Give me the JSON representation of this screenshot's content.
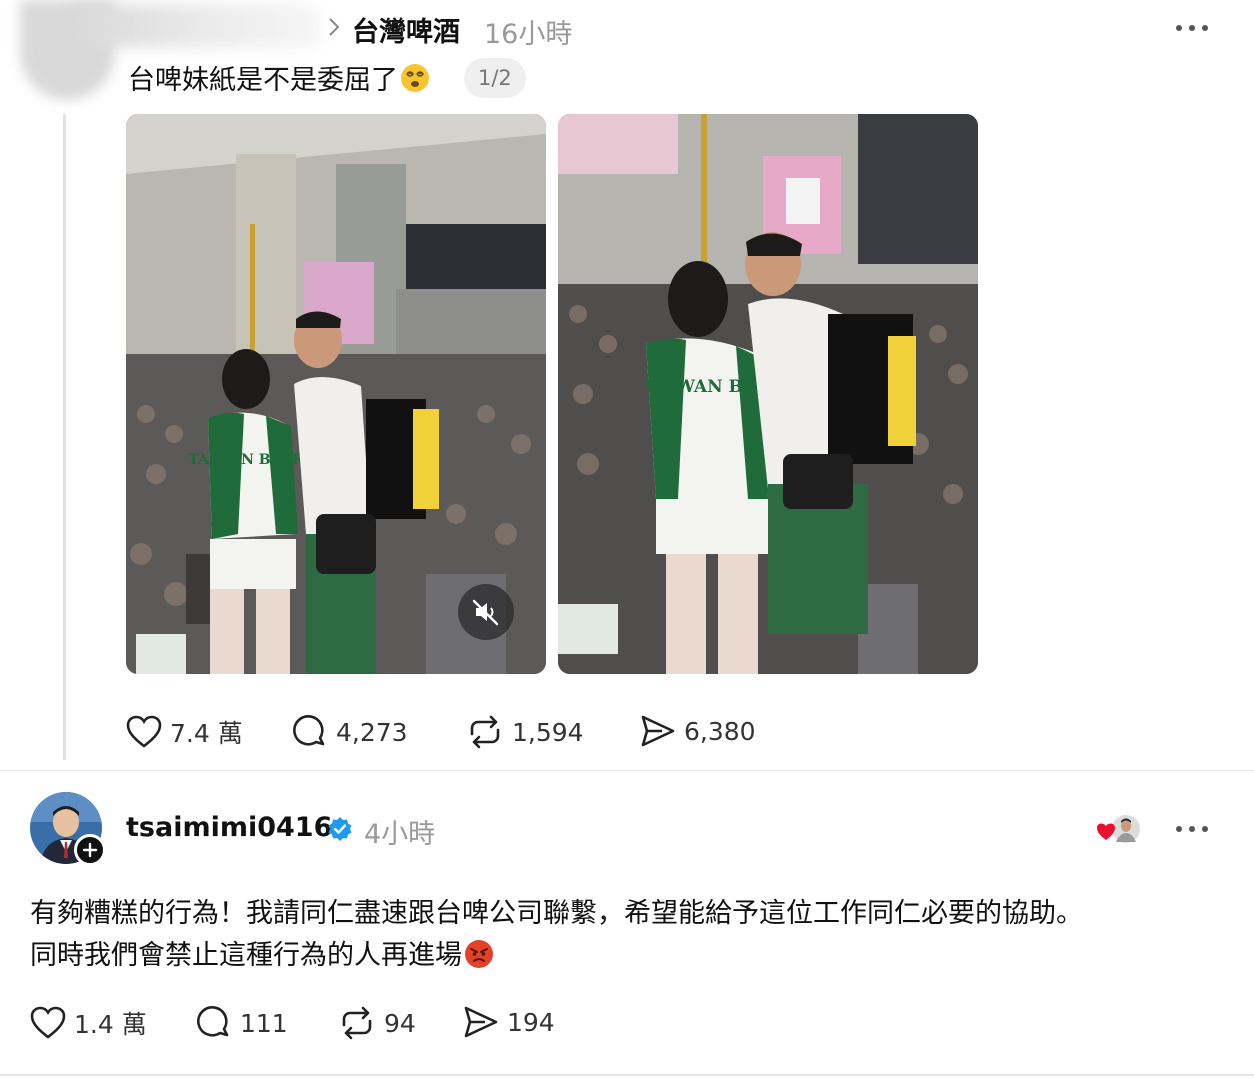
{
  "quoted_post": {
    "author": "台灣啤酒",
    "time": "16小時",
    "text": "台啤妹紙是不是委屈了",
    "emoji": "dizzy-face-emoji",
    "page_indicator": "1/2",
    "media": [
      {
        "label": "TAIWAN BEER",
        "kind": "video"
      },
      {
        "label": "TAIWAN BEER",
        "kind": "video"
      }
    ],
    "stats": {
      "likes": "7.4 萬",
      "comments": "4,273",
      "reposts": "1,594",
      "shares": "6,380"
    }
  },
  "reply_post": {
    "username": "tsaimimi0416",
    "time": "4小時",
    "line1": "有夠糟糕的行為！我請同仁盡速跟台啤公司聯繫，希望能給予這位工作同仁必要的協助。",
    "line2": "同時我們會禁止這種行為的人再進場",
    "emoji": "angry-face-emoji",
    "stats": {
      "likes": "1.4 萬",
      "comments": "111",
      "reposts": "94",
      "shares": "194"
    }
  },
  "colors": {
    "verified": "#1d9bf0",
    "like_heart": "#e8102e",
    "jersey_green": "#1f6b3a"
  }
}
